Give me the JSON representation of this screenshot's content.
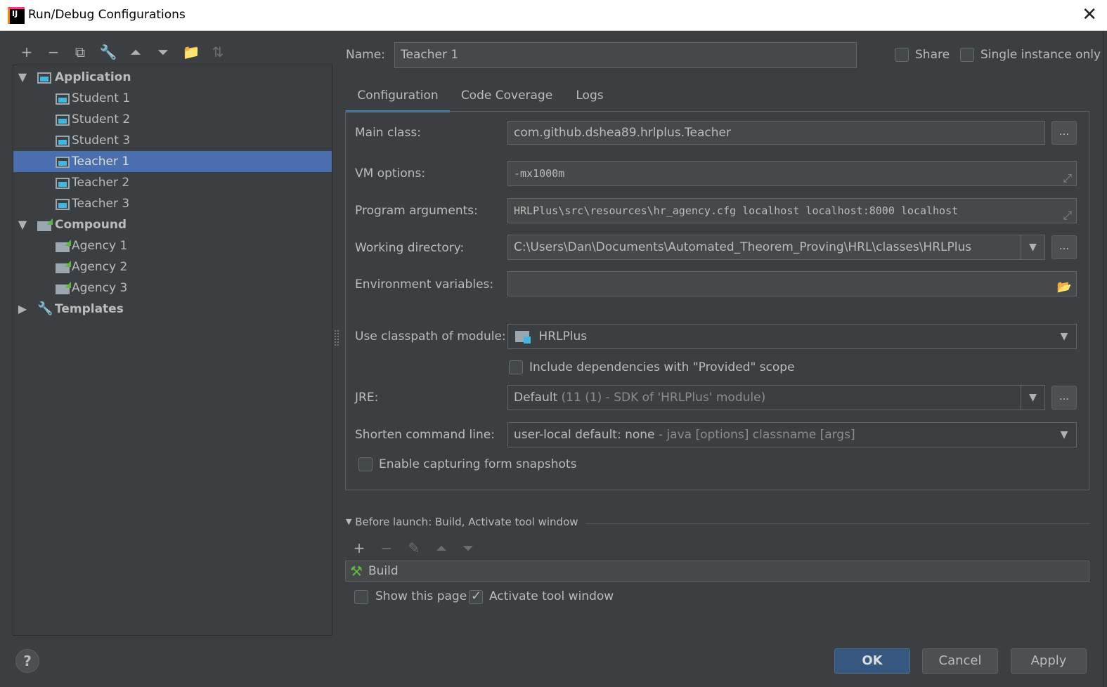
{
  "window": {
    "title": "Run/Debug Configurations",
    "close_glyph": "✕"
  },
  "toolbar": [
    {
      "name": "add-config-button",
      "glyph": "+",
      "dim": false
    },
    {
      "name": "remove-config-button",
      "glyph": "−",
      "dim": false
    },
    {
      "name": "copy-config-button",
      "glyph": "⧉",
      "dim": false
    },
    {
      "name": "edit-defaults-button",
      "glyph": "🔧",
      "dim": false
    },
    {
      "name": "move-up-button",
      "glyph": "⏶",
      "dim": false
    },
    {
      "name": "move-down-button",
      "glyph": "⏷",
      "dim": false
    },
    {
      "name": "new-folder-button",
      "glyph": "📁",
      "dim": false
    },
    {
      "name": "sort-button",
      "glyph": "⇅",
      "dim": true
    }
  ],
  "tree": {
    "groups": [
      {
        "label": "Application",
        "expanded": true,
        "icon": "application-icon",
        "items": [
          "Student 1",
          "Student 2",
          "Student 3",
          "Teacher 1",
          "Teacher 2",
          "Teacher 3"
        ]
      },
      {
        "label": "Compound",
        "expanded": true,
        "icon": "compound-icon",
        "items": [
          "Agency 1",
          "Agency 2",
          "Agency 3"
        ]
      },
      {
        "label": "Templates",
        "expanded": false,
        "icon": "wrench-icon",
        "items": []
      }
    ],
    "selected": "Teacher 1"
  },
  "header": {
    "name_label": "Name:",
    "name_value": "Teacher 1",
    "share_label": "Share",
    "share_checked": false,
    "single_instance_label": "Single instance only",
    "single_instance_checked": false
  },
  "tabs": [
    {
      "label": "Configuration",
      "active": true
    },
    {
      "label": "Code Coverage",
      "active": false
    },
    {
      "label": "Logs",
      "active": false
    }
  ],
  "config": {
    "main_class_label": "Main class:",
    "main_class_value": "com.github.dshea89.hrlplus.Teacher",
    "vm_options_label": "VM options:",
    "vm_options_value": "-mx1000m",
    "program_args_label": "Program arguments:",
    "program_args_value": "HRLPlus\\src\\resources\\hr_agency.cfg localhost localhost:8000 localhost",
    "working_dir_label": "Working directory:",
    "working_dir_value": "C:\\Users\\Dan\\Documents\\Automated_Theorem_Proving\\HRL\\classes\\HRLPlus",
    "env_vars_label": "Environment variables:",
    "env_vars_value": "",
    "classpath_label": "Use classpath of module:",
    "classpath_value": "HRLPlus",
    "include_deps_label": "Include dependencies with \"Provided\" scope",
    "include_deps_checked": false,
    "jre_label": "JRE:",
    "jre_value": "Default",
    "jre_detail": "(11 (1) - SDK of 'HRLPlus' module)",
    "shorten_label": "Shorten command line:",
    "shorten_value": "user-local default: none",
    "shorten_detail": "- java [options] classname [args]",
    "snapshots_label": "Enable capturing form snapshots",
    "snapshots_checked": false,
    "ellipsis": "...",
    "expand_glyph": "⤢",
    "dropdown_glyph": "▼",
    "folder_glyph": "📂"
  },
  "before_launch": {
    "title": "Before launch: Build, Activate tool window",
    "collapse_glyph": "▼",
    "toolbar": [
      {
        "name": "add-task-button",
        "glyph": "+",
        "dim": false
      },
      {
        "name": "remove-task-button",
        "glyph": "−",
        "dim": true
      },
      {
        "name": "edit-task-button",
        "glyph": "✎",
        "dim": true
      },
      {
        "name": "task-up-button",
        "glyph": "⏶",
        "dim": true
      },
      {
        "name": "task-down-button",
        "glyph": "⏷",
        "dim": true
      }
    ],
    "tasks": [
      "Build"
    ],
    "show_page_label": "Show this page",
    "show_page_checked": false,
    "activate_label": "Activate tool window",
    "activate_checked": true
  },
  "footer": {
    "help_glyph": "?",
    "ok_label": "OK",
    "cancel_label": "Cancel",
    "apply_label": "Apply"
  }
}
